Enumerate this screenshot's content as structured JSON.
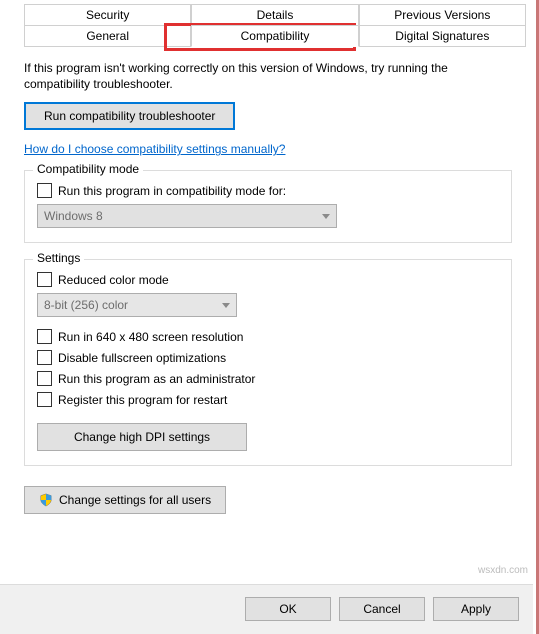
{
  "tabs": {
    "row1": [
      "Security",
      "Details",
      "Previous Versions"
    ],
    "row2": [
      "General",
      "Compatibility",
      "Digital Signatures"
    ],
    "active": "Compatibility"
  },
  "intro": "If this program isn't working correctly on this version of Windows, try running the compatibility troubleshooter.",
  "troubleshoot_btn": "Run compatibility troubleshooter",
  "manual_link": "How do I choose compatibility settings manually?",
  "compat_mode": {
    "title": "Compatibility mode",
    "check_label": "Run this program in compatibility mode for:",
    "select_value": "Windows 8"
  },
  "settings": {
    "title": "Settings",
    "reduced_color": "Reduced color mode",
    "color_select": "8-bit (256) color",
    "run_640": "Run in 640 x 480 screen resolution",
    "disable_fullscreen": "Disable fullscreen optimizations",
    "run_admin": "Run this program as an administrator",
    "register_restart": "Register this program for restart",
    "dpi_btn": "Change high DPI settings"
  },
  "all_users_btn": "Change settings for all users",
  "footer": {
    "ok": "OK",
    "cancel": "Cancel",
    "apply": "Apply"
  },
  "watermark": "wsxdn.com"
}
